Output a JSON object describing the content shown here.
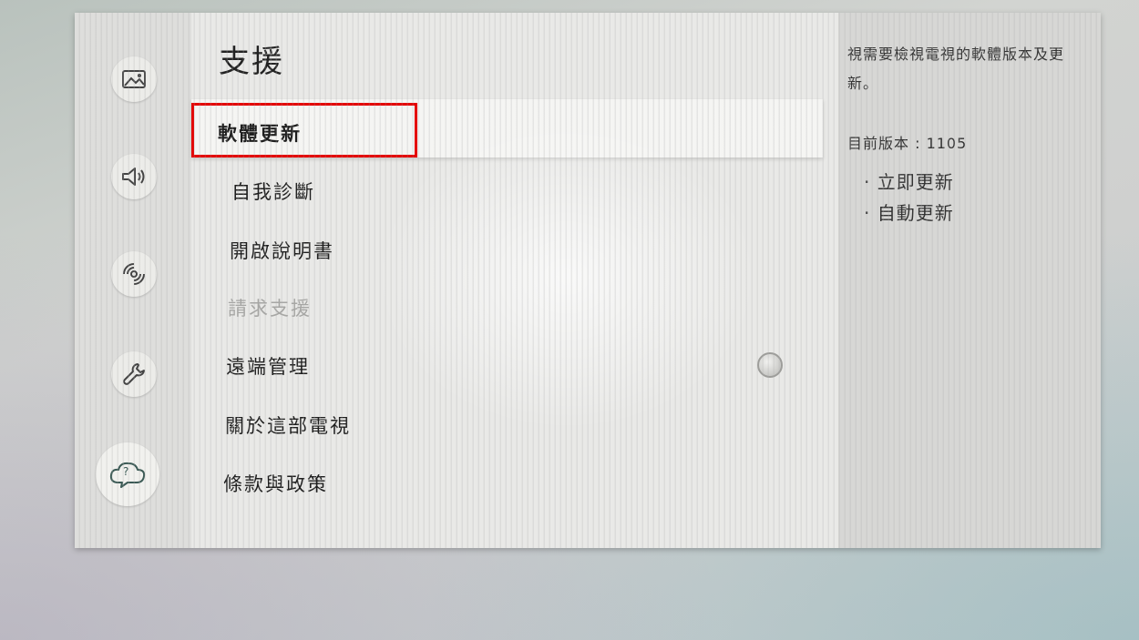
{
  "header": {
    "title": "支援"
  },
  "sidebar": {
    "icons": [
      {
        "name": "picture-icon"
      },
      {
        "name": "sound-icon"
      },
      {
        "name": "network-icon"
      },
      {
        "name": "wrench-icon"
      },
      {
        "name": "help-cloud-icon",
        "active": true,
        "glyph": "?"
      }
    ]
  },
  "menu": {
    "items": [
      {
        "label": "軟體更新",
        "state": "selected"
      },
      {
        "label": "自我診斷",
        "state": "normal"
      },
      {
        "label": "開啟說明書",
        "state": "normal"
      },
      {
        "label": "請求支援",
        "state": "disabled"
      },
      {
        "label": "遠端管理",
        "state": "normal"
      },
      {
        "label": "關於這部電視",
        "state": "normal"
      },
      {
        "label": "條款與政策",
        "state": "normal"
      }
    ]
  },
  "info": {
    "description": "視需要檢視電視的軟體版本及更新。",
    "version_label": "目前版本 : 1105",
    "actions": [
      "· 立即更新",
      "· 自動更新"
    ]
  },
  "colors": {
    "highlight_border": "#e40000",
    "screen_bg": "#e9e9e7",
    "info_bg": "#d7d7d5"
  }
}
